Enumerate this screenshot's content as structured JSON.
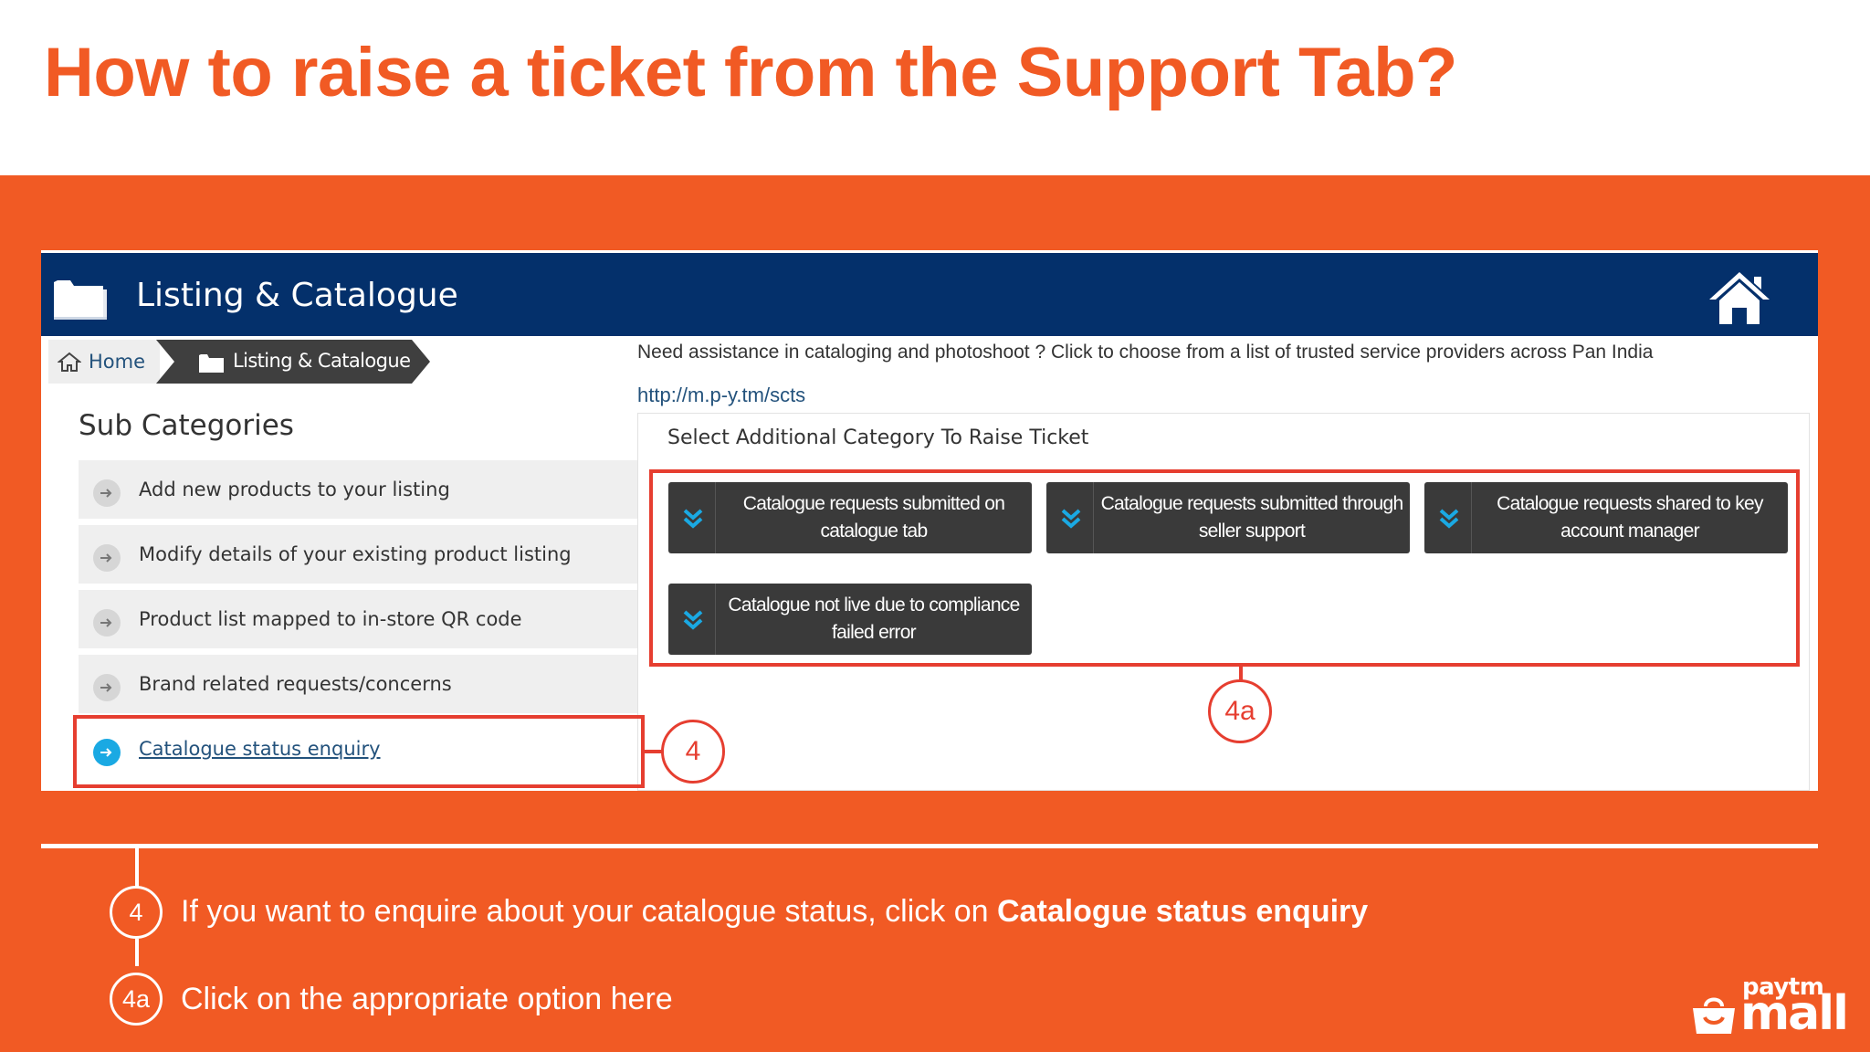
{
  "slide": {
    "title": "How to raise a ticket from the Support Tab?"
  },
  "colors": {
    "orange": "#F15A24",
    "navy": "#04306B",
    "callout_red": "#E63E30",
    "link_blue": "#23527C",
    "active_arrow": "#1AA9E3"
  },
  "app": {
    "header_title": "Listing & Catalogue",
    "header_icon": "folder-icon",
    "home_button_icon": "home-icon"
  },
  "breadcrumb": {
    "home": "Home",
    "current": "Listing & Catalogue"
  },
  "sidebar": {
    "heading": "Sub Categories",
    "items": [
      {
        "label": "Add new products to your listing",
        "active": false
      },
      {
        "label": "Modify details of your existing product listing",
        "active": false
      },
      {
        "label": "Product list mapped to in-store QR code",
        "active": false
      },
      {
        "label": "Brand related requests/concerns",
        "active": false
      },
      {
        "label": "Catalogue status enquiry",
        "active": true
      }
    ]
  },
  "main": {
    "assist_text": "Need assistance in cataloging and photoshoot ? Click to choose from a list of trusted service providers across Pan India",
    "assist_link": "http://m.p-y.tm/scts",
    "select_label": "Select Additional Category To Raise Ticket",
    "options": [
      "Catalogue requests submitted on catalogue tab",
      "Catalogue requests submitted through seller support",
      "Catalogue requests shared to key account manager",
      "Catalogue not live due to compliance failed error"
    ]
  },
  "callouts": {
    "sidebar": "4",
    "options": "4a"
  },
  "steps": [
    {
      "num": "4",
      "text": "If you want to enquire about your catalogue status, click on ",
      "bold": "Catalogue status enquiry"
    },
    {
      "num": "4a",
      "text": "Click on the appropriate option here",
      "bold": ""
    }
  ],
  "logo": {
    "top": "paytm",
    "bottom": "mall"
  }
}
